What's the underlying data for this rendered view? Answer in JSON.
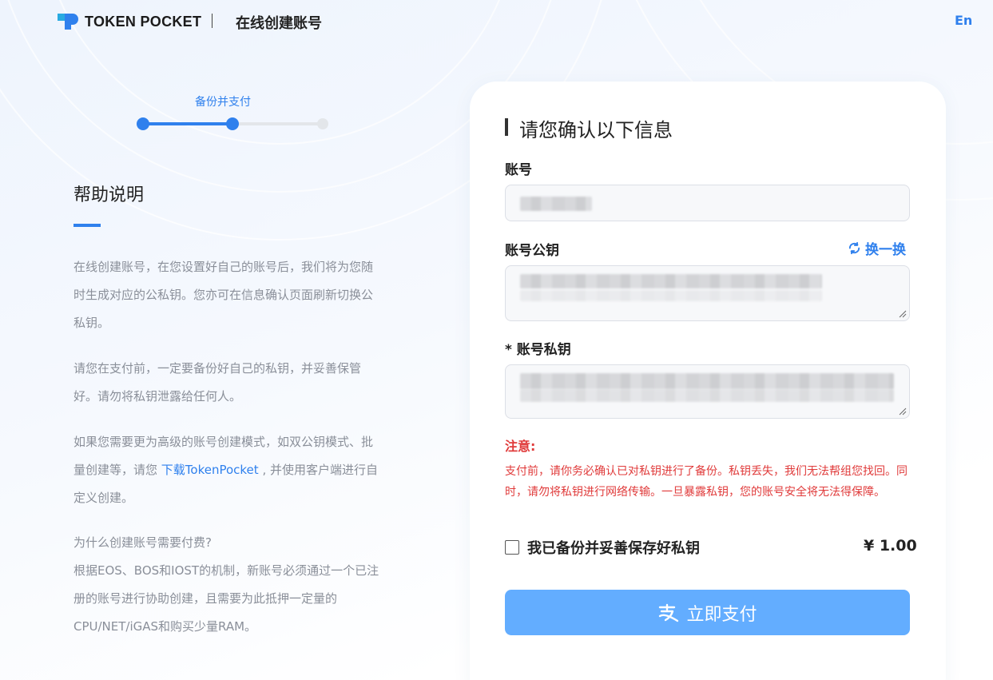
{
  "header": {
    "logo_text": "TOKEN POCKET",
    "title": "在线创建账号",
    "lang": "En"
  },
  "stepper": {
    "current_label": "备份并支付",
    "current_step": 2,
    "total_steps": 3
  },
  "help": {
    "title": "帮助说明",
    "p1": "在线创建账号，在您设置好自己的账号后，我们将为您随时生成对应的公私钥。您亦可在信息确认页面刷新切换公私钥。",
    "p2": "请您在支付前，一定要备份好自己的私钥，并妥善保管好。请勿将私钥泄露给任何人。",
    "p3_before": "如果您需要更为高级的账号创建模式，如双公钥模式、批量创建等，请您 ",
    "p3_link": "下载TokenPocket",
    "p3_after": " , 并使用客户端进行自定义创建。",
    "p4_question": "为什么创建账号需要付费?",
    "p4_answer": "根据EOS、BOS和IOST的机制，新账号必须通过一个已注册的账号进行协助创建，且需要为此抵押一定量的CPU/NET/iGAS和购买少量RAM。"
  },
  "form": {
    "title": "请您确认以下信息",
    "account_label": "账号",
    "pubkey_label": "账号公钥",
    "swap_label": "换一换",
    "privkey_label": "* 账号私钥",
    "notice_title": "注意:",
    "notice_text": "支付前，请你务必确认已对私钥进行了备份。私钥丢失，我们无法帮组您找回。同时，请勿将私钥进行网络传输。一旦暴露私钥，您的账号安全将无法得保障。",
    "backup_confirm_label": "我已备份并妥善保存好私钥",
    "backup_checked": false,
    "price": "¥ 1.00",
    "pay_button": "立即支付"
  },
  "colors": {
    "accent": "#2f80ed",
    "pay_button": "#63adff",
    "warning": "#e03b3b"
  },
  "icons": {
    "logo": "tokenpocket-logo-icon",
    "refresh": "refresh-icon",
    "pay": "alipay-icon"
  }
}
